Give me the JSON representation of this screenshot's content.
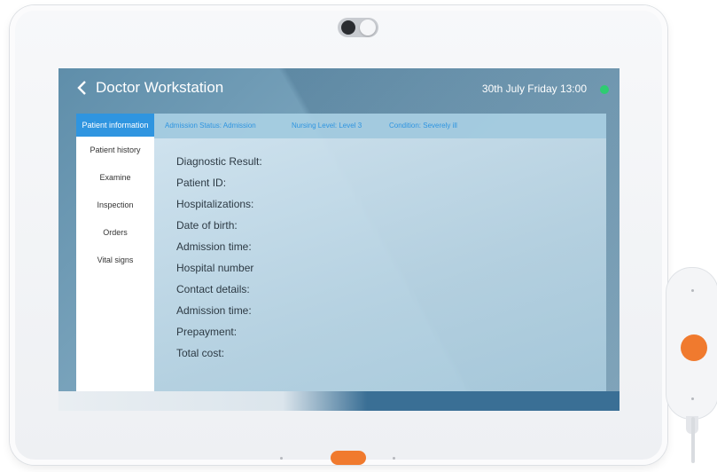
{
  "header": {
    "title": "Doctor Workstation",
    "datetime": "30th July  Friday  13:00",
    "status_color": "#2ecc71",
    "back_icon": "chevron-left-icon"
  },
  "sidebar": {
    "items": [
      {
        "label": "Patient information",
        "active": true
      },
      {
        "label": "Patient history",
        "active": false
      },
      {
        "label": "Examine",
        "active": false
      },
      {
        "label": "Inspection",
        "active": false
      },
      {
        "label": "Orders",
        "active": false
      },
      {
        "label": "Vital signs",
        "active": false
      }
    ]
  },
  "infobar": {
    "admission_status": "Admission Status: Admission",
    "nursing_level": "Nursing Level: Level 3",
    "condition": "Condition: Severely ill"
  },
  "fields": [
    "Diagnostic Result:",
    "Patient ID:",
    "Hospitalizations:",
    "Date of birth:",
    "Admission time:",
    "Hospital number",
    "Contact details:",
    "Admission time:",
    "Prepayment:",
    "Total cost:"
  ],
  "colors": {
    "accent": "#2f95e0",
    "device_button": "#f07a2e"
  }
}
